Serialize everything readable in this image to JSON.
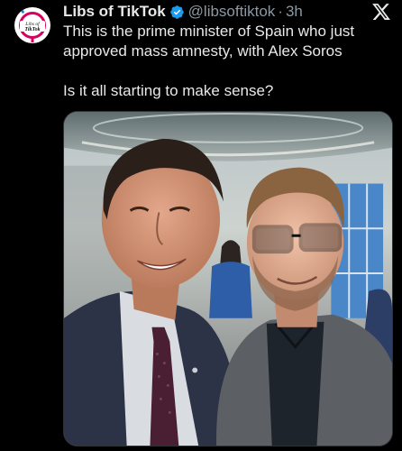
{
  "tweet": {
    "author": {
      "display_name": "Libs of TikTok",
      "handle": "@libsoftiktok",
      "verified_icon": "verified-badge-icon",
      "avatar_icon": "libs-of-tiktok-logo"
    },
    "time": "3h",
    "separator": "·",
    "text_line_1": "This is the prime minister of Spain who just approved mass amnesty, with Alex Soros",
    "text_line_2": "Is it all starting to make sense?",
    "platform_icon": "x-logo-icon",
    "media": {
      "type": "photo",
      "description_icon": "photo-two-men-selfie"
    },
    "colors": {
      "background": "#000000",
      "text": "#e7e9ea",
      "muted": "#8b98a5",
      "verified": "#1d9bf0"
    }
  }
}
